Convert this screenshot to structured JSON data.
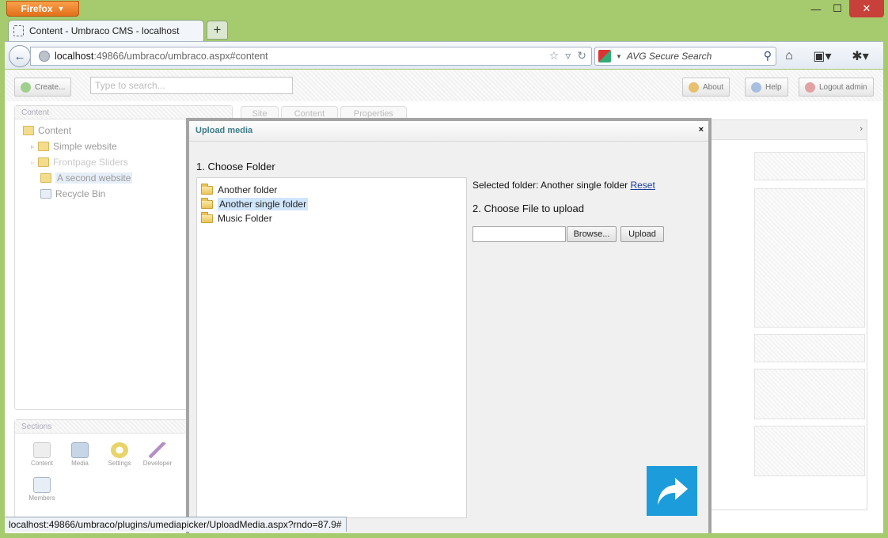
{
  "browser": {
    "app_button": "Firefox",
    "tab_title": "Content - Umbraco CMS - localhost",
    "new_tab": "+",
    "url_host": "localhost",
    "url_path": ":49866/umbraco/umbraco.aspx#content",
    "search_placeholder": "AVG Secure Search",
    "status_url": "localhost:49866/umbraco/plugins/umediapicker/UploadMedia.aspx?rndo=87.9#"
  },
  "umbraco": {
    "create_button": "Create...",
    "search_placeholder": "Type to search...",
    "about_button": "About",
    "help_button": "Help",
    "logout_button": "Logout admin",
    "tree_header": "Content",
    "tree_items": [
      {
        "label": "Content"
      },
      {
        "label": "Simple website"
      },
      {
        "label": "Frontpage Sliders"
      },
      {
        "label": "A second website"
      },
      {
        "label": "Recycle Bin"
      }
    ],
    "tabs": [
      {
        "label": "Site"
      },
      {
        "label": "Content"
      },
      {
        "label": "Properties"
      }
    ],
    "sections_header": "Sections",
    "sections": [
      {
        "label": "Content",
        "icon": "content-section-icon"
      },
      {
        "label": "Media",
        "icon": "media-section-icon"
      },
      {
        "label": "Settings",
        "icon": "settings-section-icon"
      },
      {
        "label": "Developer",
        "icon": "developer-section-icon"
      },
      {
        "label": "Members",
        "icon": "members-section-icon"
      }
    ]
  },
  "modal": {
    "title": "Upload media",
    "close": "×",
    "step1_label": "1. Choose Folder",
    "folders": [
      {
        "label": "Another folder",
        "selected": false
      },
      {
        "label": "Another single folder",
        "selected": true
      },
      {
        "label": "Music Folder",
        "selected": false
      }
    ],
    "selected_folder_prefix": "Selected folder: Another single folder",
    "reset_link": "Reset",
    "step2_label": "2. Choose File to upload",
    "file_value": "",
    "browse_button": "Browse...",
    "upload_button": "Upload"
  },
  "colors": {
    "window_frame": "#a6ca6e",
    "modal_title_text": "#3d7c88",
    "share_tile": "#1d9cdc",
    "selection_highlight": "#cfe6fb"
  }
}
